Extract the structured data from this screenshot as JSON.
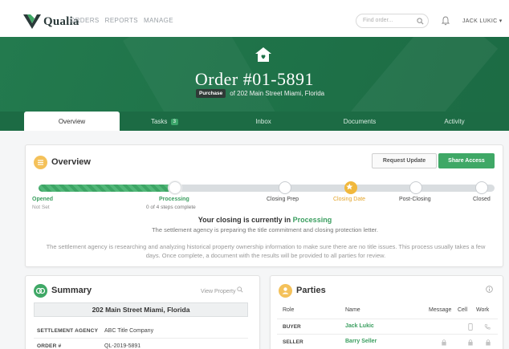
{
  "nav": {
    "brand": "Qualia",
    "links": [
      "ORDERS",
      "REPORTS",
      "MANAGE"
    ],
    "search_placeholder": "Find order...",
    "user": "JACK LUKIC"
  },
  "header": {
    "order_title": "Order #01-5891",
    "tag": "Purchase",
    "subtitle": "of 202 Main Street Miami, Florida"
  },
  "tabs": [
    {
      "label": "Overview"
    },
    {
      "label": "Tasks",
      "badge": "3"
    },
    {
      "label": "Inbox"
    },
    {
      "label": "Documents"
    },
    {
      "label": "Activity"
    }
  ],
  "overview": {
    "title": "Overview",
    "request_update": "Request Update",
    "share_access": "Share Access",
    "steps": [
      {
        "label": "Opened",
        "sub": "Not Set"
      },
      {
        "label": "Processing",
        "sub": "0 of 4 steps complete"
      },
      {
        "label": "Closing Prep"
      },
      {
        "label": "Closing Date"
      },
      {
        "label": "Post-Closing"
      },
      {
        "label": "Closed"
      }
    ],
    "status_prefix": "Your closing is currently in",
    "status_value": "Processing",
    "status_sub": "The settlement agency is preparing the title commitment and closing protection letter.",
    "status_desc": "The settlement agency is researching and analyzing historical property ownership information to make sure there are no title issues. This process usually takes a few days. Once complete, a document with the results will be provided to all parties for review."
  },
  "summary": {
    "title": "Summary",
    "view_property": "View Property",
    "address": "202 Main Street Miami, Florida",
    "rows": [
      {
        "key": "SETTLEMENT AGENCY",
        "value": "ABC Title Company"
      },
      {
        "key": "ORDER #",
        "value": "QL-2019-5891"
      }
    ]
  },
  "parties": {
    "title": "Parties",
    "columns": [
      "Role",
      "Name",
      "Message",
      "Cell",
      "Work"
    ],
    "rows": [
      {
        "role": "BUYER",
        "name": "Jack Lukic"
      },
      {
        "role": "SELLER",
        "name": "Barry Seller"
      }
    ]
  },
  "colors": {
    "brand_green": "#1f7349",
    "accent_green": "#3a9e5f",
    "closing_date_gold": "#f1b83c"
  }
}
